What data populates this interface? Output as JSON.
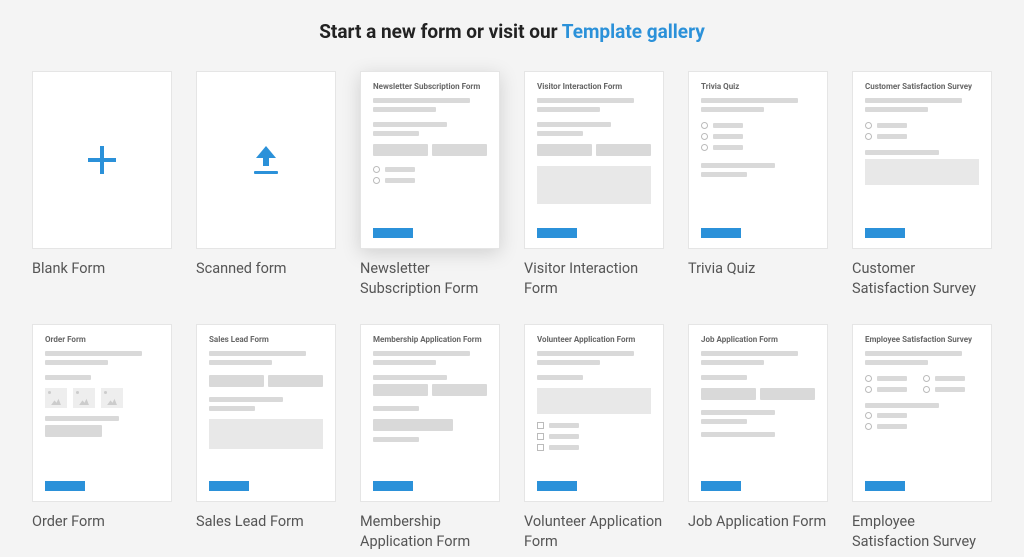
{
  "header": {
    "prefix": "Start a new form or visit our ",
    "link_text": "Template gallery"
  },
  "templates": [
    {
      "kind": "blank",
      "title": "",
      "caption": "Blank Form"
    },
    {
      "kind": "scan",
      "title": "",
      "caption": "Scanned form"
    },
    {
      "kind": "tpl",
      "title": "Newsletter Subscription Form",
      "caption": "Newsletter Subscription Form",
      "variant": "newsletter",
      "highlight": true
    },
    {
      "kind": "tpl",
      "title": "Visitor Interaction Form",
      "caption": "Visitor Interaction Form",
      "variant": "visitor"
    },
    {
      "kind": "tpl",
      "title": "Trivia Quiz",
      "caption": "Trivia Quiz",
      "variant": "trivia"
    },
    {
      "kind": "tpl",
      "title": "Customer Satisfaction Survey",
      "caption": "Customer Satisfaction Survey",
      "variant": "csat"
    },
    {
      "kind": "tpl",
      "title": "Order Form",
      "caption": "Order Form",
      "variant": "order"
    },
    {
      "kind": "tpl",
      "title": "Sales Lead Form",
      "caption": "Sales Lead Form",
      "variant": "sales"
    },
    {
      "kind": "tpl",
      "title": "Membership Application Form",
      "caption": "Membership Application Form",
      "variant": "membership"
    },
    {
      "kind": "tpl",
      "title": "Volunteer Application Form",
      "caption": "Volunteer Application Form",
      "variant": "volunteer"
    },
    {
      "kind": "tpl",
      "title": "Job Application Form",
      "caption": "Job Application Form",
      "variant": "job"
    },
    {
      "kind": "tpl",
      "title": "Employee Satisfaction Survey",
      "caption": "Employee Satisfaction Survey",
      "variant": "esat"
    }
  ]
}
